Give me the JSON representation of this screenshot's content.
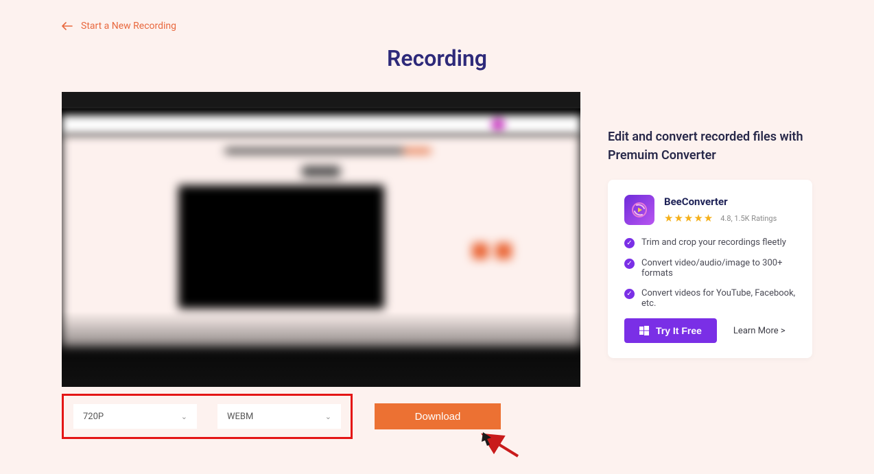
{
  "nav": {
    "back_label": "Start a New Recording"
  },
  "title": "Recording",
  "options": {
    "resolution": "720P",
    "format": "WEBM",
    "download_label": "Download"
  },
  "promo": {
    "heading": "Edit and convert recorded files with Premuim Converter",
    "product_name": "BeeConverter",
    "rating_text": "4.8, 1.5K Ratings",
    "features": [
      "Trim and crop your recordings fleetly",
      "Convert video/audio/image to 300+ formats",
      "Convert videos for YouTube, Facebook, etc."
    ],
    "try_label": "Try It Free",
    "learn_more_label": "Learn More >"
  }
}
